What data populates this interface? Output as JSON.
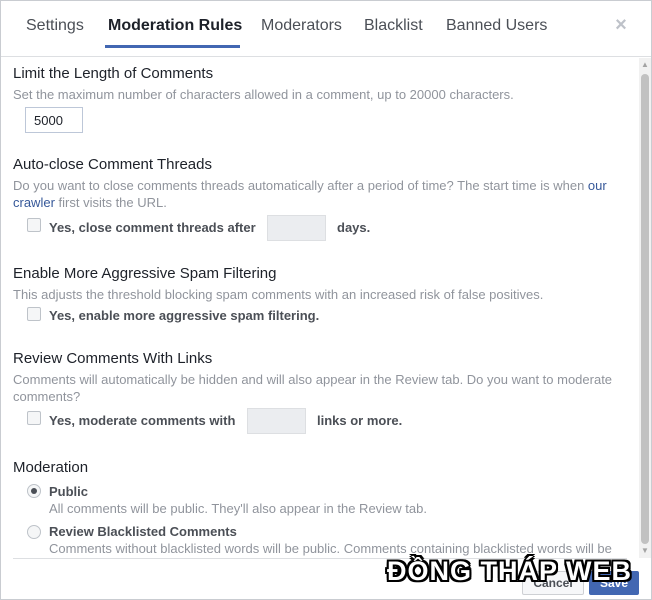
{
  "tabs": [
    {
      "label": "Settings"
    },
    {
      "label": "Moderation Rules"
    },
    {
      "label": "Moderators"
    },
    {
      "label": "Blacklist"
    },
    {
      "label": "Banned Users"
    }
  ],
  "close_glyph": "×",
  "length": {
    "title": "Limit the Length of Comments",
    "description": "Set the maximum number of characters allowed in a comment, up to 20000 characters.",
    "value": "5000"
  },
  "autoclose": {
    "title": "Auto-close Comment Threads",
    "description_before": "Do you want to close comments threads automatically after a period of time? The start time is when ",
    "link": "our crawler",
    "description_after": " first visits the URL.",
    "checkbox_label": "Yes, close comment threads after",
    "days_value": "",
    "suffix": "days."
  },
  "spam": {
    "title": "Enable More Aggressive Spam Filtering",
    "description": "This adjusts the threshold blocking spam comments with an increased risk of false positives.",
    "checkbox_label": "Yes, enable more aggressive spam filtering."
  },
  "links": {
    "title": "Review Comments With Links",
    "description": "Comments will automatically be hidden and will also appear in the Review tab. Do you want to moderate comments?",
    "checkbox_label": "Yes, moderate comments with",
    "links_value": "",
    "suffix": "links or more."
  },
  "moderation": {
    "title": "Moderation",
    "options": [
      {
        "label": "Public",
        "description": "All comments will be public. They'll also appear in the Review tab.",
        "selected": true
      },
      {
        "label": "Review Blacklisted Comments",
        "description": "Comments without blacklisted words will be public. Comments containing blacklisted words will be",
        "selected": false
      }
    ]
  },
  "footer": {
    "cancel_label": "Cancel",
    "save_label": "Save"
  },
  "watermark": "ĐỒNG THÁP WEB",
  "colors": {
    "accent": "#4267b2",
    "link": "#365899",
    "muted_text": "#90949c"
  }
}
